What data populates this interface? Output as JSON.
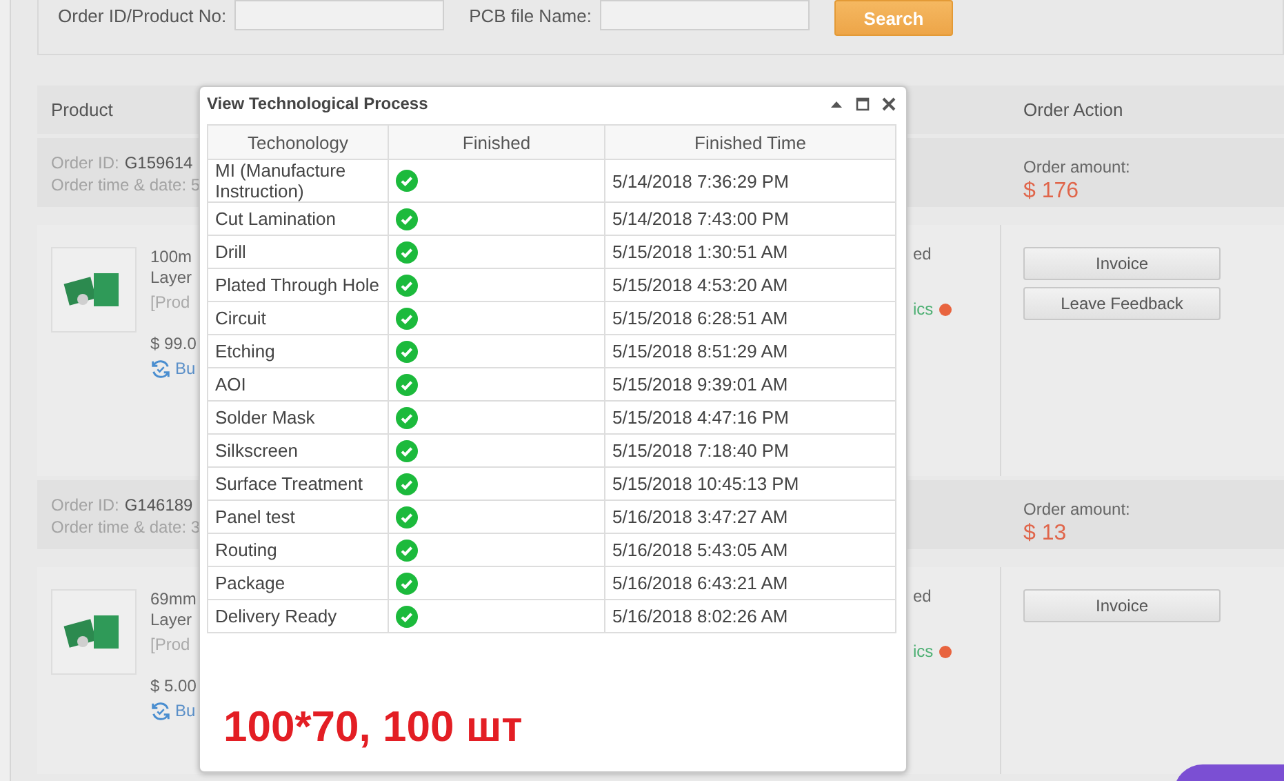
{
  "filters": {
    "fields": [
      {
        "label": "Order ID/Product No:"
      },
      {
        "label": "PCB file Name:"
      }
    ],
    "search_button": "Search"
  },
  "table": {
    "columns": [
      {
        "label": "Product"
      },
      {
        "label": "Order Action"
      }
    ]
  },
  "orders": [
    {
      "order_id_label": "Order ID:",
      "order_id": "G159614",
      "date_label": "Order time & date: 5",
      "amount_label": "Order amount:",
      "amount": "$ 176",
      "product_lines": [
        "100m",
        "Layer",
        "[Prod"
      ],
      "price": "$ 99.0",
      "rebuy": "Bu",
      "status": "ed",
      "tracking": "ics",
      "actions": [
        "Invoice",
        "Leave Feedback"
      ]
    },
    {
      "order_id_label": "Order ID:",
      "order_id": "G146189",
      "date_label": "Order time & date: 3",
      "amount_label": "Order amount:",
      "amount": "$ 13",
      "product_lines": [
        "69mm",
        "Layer",
        "[Prod"
      ],
      "price": "$ 5.00",
      "rebuy": "Bu",
      "status": "ed",
      "tracking": "ics",
      "actions": [
        "Invoice"
      ]
    }
  ],
  "dialog": {
    "title": "View Technological Process",
    "columns": [
      "Techonology",
      "Finished",
      "Finished Time"
    ],
    "rows": [
      {
        "step": "MI (Manufacture Instruction)",
        "finished": true,
        "time": "5/14/2018 7:36:29 PM"
      },
      {
        "step": "Cut Lamination",
        "finished": true,
        "time": "5/14/2018 7:43:00 PM"
      },
      {
        "step": "Drill",
        "finished": true,
        "time": "5/15/2018 1:30:51 AM"
      },
      {
        "step": "Plated Through Hole",
        "finished": true,
        "time": "5/15/2018 4:53:20 AM"
      },
      {
        "step": "Circuit",
        "finished": true,
        "time": "5/15/2018 6:28:51 AM"
      },
      {
        "step": "Etching",
        "finished": true,
        "time": "5/15/2018 8:51:29 AM"
      },
      {
        "step": "AOI",
        "finished": true,
        "time": "5/15/2018 9:39:01 AM"
      },
      {
        "step": "Solder Mask",
        "finished": true,
        "time": "5/15/2018 4:47:16 PM"
      },
      {
        "step": "Silkscreen",
        "finished": true,
        "time": "5/15/2018 7:18:40 PM"
      },
      {
        "step": "Surface Treatment",
        "finished": true,
        "time": "5/15/2018 10:45:13 PM"
      },
      {
        "step": "Panel test",
        "finished": true,
        "time": "5/16/2018 3:47:27 AM"
      },
      {
        "step": "Routing",
        "finished": true,
        "time": "5/16/2018 5:43:05 AM"
      },
      {
        "step": "Package",
        "finished": true,
        "time": "5/16/2018 6:43:21 AM"
      },
      {
        "step": "Delivery Ready",
        "finished": true,
        "time": "5/16/2018 8:02:26 AM"
      }
    ],
    "note": "100*70, 100 шт"
  }
}
